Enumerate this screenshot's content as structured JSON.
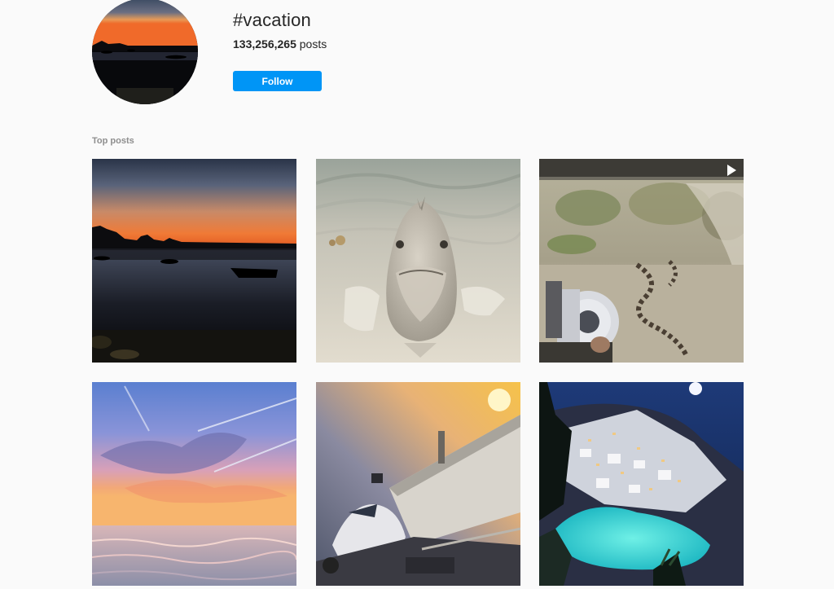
{
  "hashtag": {
    "title": "#vacation",
    "post_count": "133,256,265",
    "post_suffix": " posts",
    "follow_label": "Follow"
  },
  "section": {
    "label": "Top posts"
  },
  "posts": [
    {
      "subject": "sunset-lagoon-boats",
      "type": "image"
    },
    {
      "subject": "fish-on-sand",
      "type": "image"
    },
    {
      "subject": "camera-wildebeest-river-crossing",
      "type": "video"
    },
    {
      "subject": "pastel-sunset-beach",
      "type": "image"
    },
    {
      "subject": "airplane-at-gate-sunset",
      "type": "image"
    },
    {
      "subject": "santorini-night-pool",
      "type": "image"
    }
  ],
  "colors": {
    "accent": "#0095f6",
    "background": "#fafafa",
    "muted_text": "#8e8e8e"
  }
}
